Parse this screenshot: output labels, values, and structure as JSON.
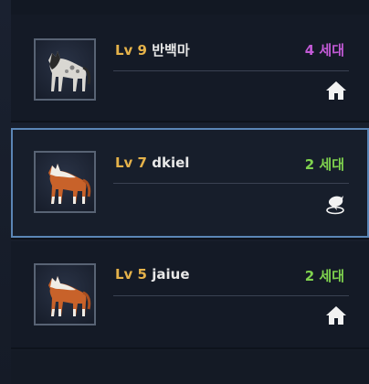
{
  "colors": {
    "level": "#e5b24a",
    "name": "#e8e8e8",
    "gen_purple": "#c25ad6",
    "gen_green": "#7fd24e",
    "selected_border": "#5b86b6"
  },
  "horses": [
    {
      "level_label": "Lv 9",
      "name": "반백마",
      "generation": "4 세대",
      "generation_color": "purple",
      "status_icon": "home-icon",
      "coat": "dapple-gray"
    },
    {
      "level_label": "Lv 7",
      "name": "dkiel",
      "generation": "2 세대",
      "generation_color": "green",
      "status_icon": "dolphin-icon",
      "coat": "chestnut-white",
      "selected": true
    },
    {
      "level_label": "Lv 5",
      "name": "jaiue",
      "generation": "2 세대",
      "generation_color": "green",
      "status_icon": "home-icon",
      "coat": "chestnut-white"
    }
  ]
}
